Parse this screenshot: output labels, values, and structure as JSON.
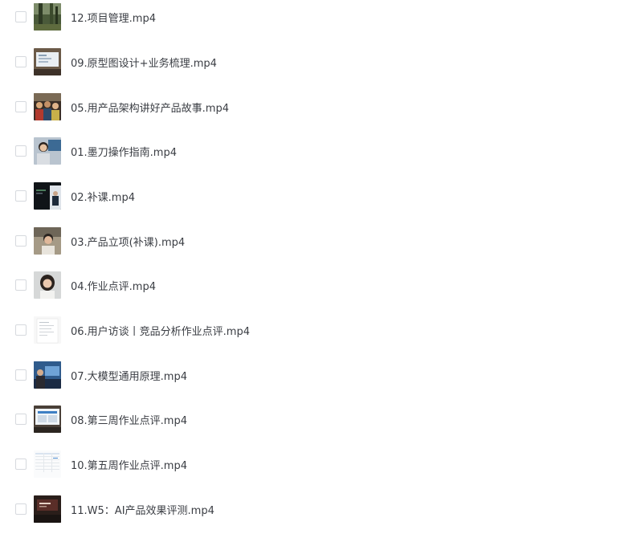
{
  "files": [
    {
      "name": "12.项目管理.mp4",
      "thumbnail": "forest-scene-thumbnail"
    },
    {
      "name": "09.原型图设计+业务梳理.mp4",
      "thumbnail": "whiteboard-screen-thumbnail"
    },
    {
      "name": "05.用产品架构讲好产品故事.mp4",
      "thumbnail": "crowd-scene-thumbnail"
    },
    {
      "name": "01.墨刀操作指南.mp4",
      "thumbnail": "woman-speaker-thumbnail"
    },
    {
      "name": "02.补课.mp4",
      "thumbnail": "dark-slide-speaker-thumbnail"
    },
    {
      "name": "03.产品立项(补课).mp4",
      "thumbnail": "speaker-indoor-thumbnail"
    },
    {
      "name": "04.作业点评.mp4",
      "thumbnail": "woman-portrait-thumbnail"
    },
    {
      "name": "06.用户访谈丨竞品分析作业点评.mp4",
      "thumbnail": "document-page-thumbnail"
    },
    {
      "name": "07.大模型通用原理.mp4",
      "thumbnail": "blue-slide-speaker-thumbnail"
    },
    {
      "name": "08.第三周作业点评.mp4",
      "thumbnail": "screen-slide-thumbnail"
    },
    {
      "name": "10.第五周作业点评.mp4",
      "thumbnail": "spreadsheet-thumbnail"
    },
    {
      "name": "11.W5：AI产品效果评测.mp4",
      "thumbnail": "dark-presentation-thumbnail"
    }
  ]
}
